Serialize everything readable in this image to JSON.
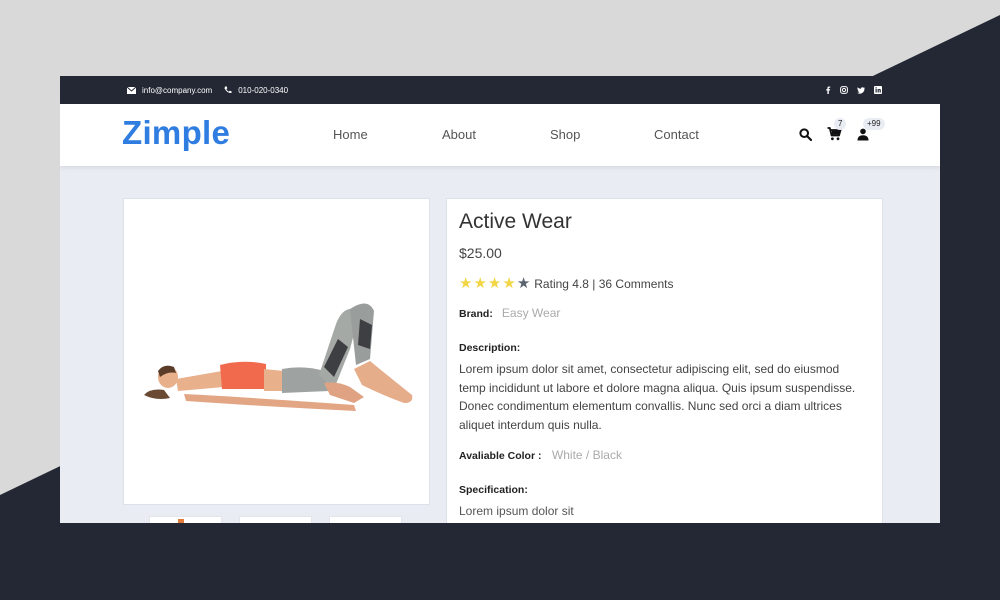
{
  "topbar": {
    "email": "info@company.com",
    "phone": "010-020-0340",
    "social": [
      "facebook-icon",
      "instagram-icon",
      "twitter-icon",
      "linkedin-icon"
    ]
  },
  "nav": {
    "logo": "Zimple",
    "menu": [
      "Home",
      "About",
      "Shop",
      "Contact"
    ],
    "cart_count": "7",
    "user_count": "+99"
  },
  "product": {
    "title": "Active Wear",
    "price": "$25.00",
    "rating_value": 4.8,
    "stars_filled": 4,
    "stars_total": 5,
    "rating_text": "Rating 4.8 | 36 Comments",
    "brand_label": "Brand:",
    "brand_value": "Easy Wear",
    "description_label": "Description:",
    "description": "Lorem ipsum dolor sit amet, consectetur adipiscing elit, sed do eiusmod temp incididunt ut labore et dolore magna aliqua. Quis ipsum suspendisse. Donec condimentum elementum convallis. Nunc sed orci a diam ultrices aliquet interdum quis nulla.",
    "color_label": "Avaliable Color :",
    "color_value": "White / Black",
    "spec_label": "Specification:",
    "spec_text": "Lorem ipsum dolor sit"
  },
  "colors": {
    "brand": "#2f7de1",
    "topbar": "#232834",
    "star_filled": "#f2d646",
    "star_empty": "#5b6270"
  }
}
